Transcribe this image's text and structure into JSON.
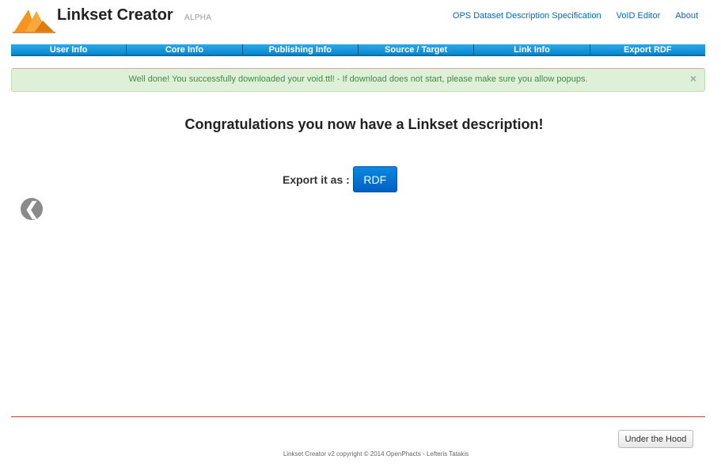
{
  "header": {
    "title": "Linkset Creator",
    "badge": "ALPHA",
    "links": [
      "OPS Dataset Description Specification",
      "VoID Editor",
      "About"
    ]
  },
  "nav": {
    "tabs": [
      "User Info",
      "Core Info",
      "Publishing Info",
      "Source / Target",
      "Link Info",
      "Export RDF"
    ]
  },
  "alert": {
    "message": "Well done! You successfully downloaded your void.ttl! - If download does not start, please make sure you allow popups.",
    "close": "×"
  },
  "main": {
    "heading": "Congratulations you now have a Linkset description!",
    "export_label": "Export it as :",
    "export_button": "RDF",
    "back_glyph": "❮"
  },
  "footer": {
    "hood_button": "Under the Hood",
    "copyright": "Linkset Creator v2 copyright © 2014 OpenPhacts - Lefteris Tatakis"
  },
  "colors": {
    "nav_blue": "#0c86cc",
    "link_blue": "#0069c4",
    "alert_bg": "#dff0d8",
    "alert_text": "#468847",
    "divider_red": "#cc3333",
    "logo_orange": "#f7941d"
  }
}
